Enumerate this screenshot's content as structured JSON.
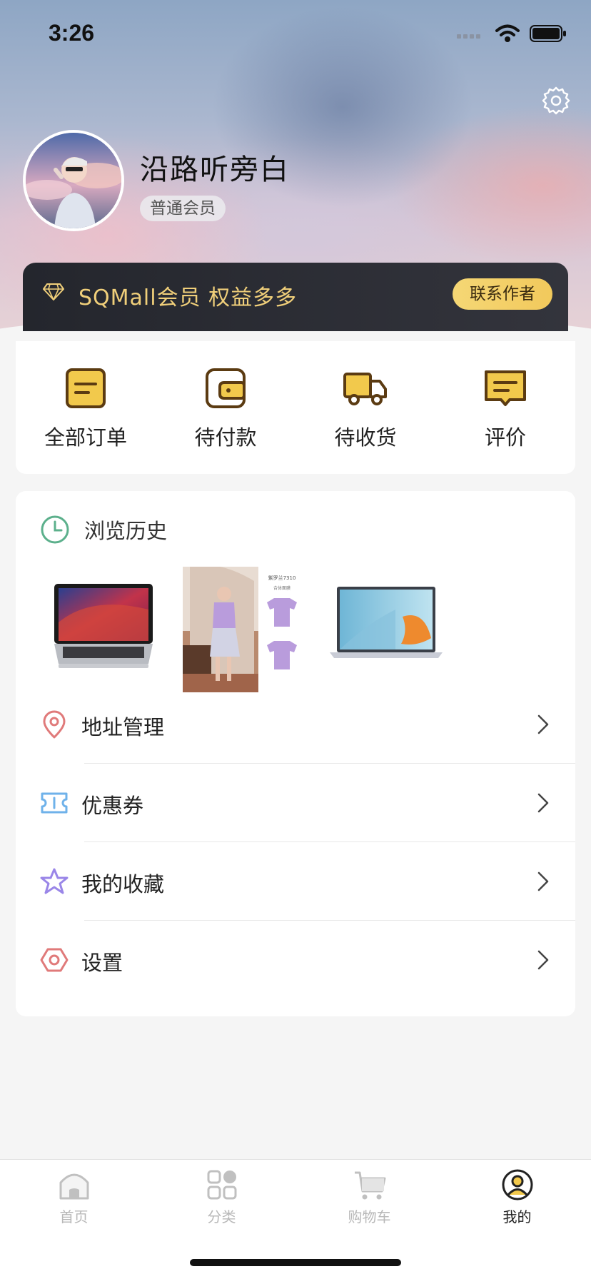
{
  "status_bar": {
    "time": "3:26"
  },
  "profile": {
    "name": "沿路听旁白",
    "level": "普通会员"
  },
  "vip": {
    "text": "SQMall会员 权益多多",
    "button": "联系作者"
  },
  "orders": [
    {
      "label": "全部订单",
      "icon": "order-list-icon"
    },
    {
      "label": "待付款",
      "icon": "wallet-icon"
    },
    {
      "label": "待收货",
      "icon": "delivery-truck-icon"
    },
    {
      "label": "评价",
      "icon": "comment-icon"
    }
  ],
  "history": {
    "title": "浏览历史",
    "items": [
      {
        "icon": "laptop-macbook-image"
      },
      {
        "icon": "clothing-tshirt-image",
        "caption_top": "紫罗兰7310",
        "caption_sub": "合体面膜"
      },
      {
        "icon": "laptop-windows-image"
      }
    ]
  },
  "menu": [
    {
      "label": "地址管理",
      "icon": "location-pin-icon"
    },
    {
      "label": "优惠券",
      "icon": "coupon-icon"
    },
    {
      "label": "我的收藏",
      "icon": "star-icon"
    },
    {
      "label": "设置",
      "icon": "hexagon-settings-icon"
    }
  ],
  "tabs": [
    {
      "label": "首页",
      "icon": "home-icon"
    },
    {
      "label": "分类",
      "icon": "category-icon"
    },
    {
      "label": "购物车",
      "icon": "cart-icon"
    },
    {
      "label": "我的",
      "icon": "profile-icon",
      "active": true
    }
  ],
  "colors": {
    "accent": "#f2c94c",
    "icon_stroke": "#5b3b12",
    "vip_gold": "#f0cf7a",
    "history_green": "#5cb08c",
    "pin_red": "#e07a7a",
    "coupon_blue": "#6fb2ea",
    "star_purple": "#9a86e8"
  }
}
